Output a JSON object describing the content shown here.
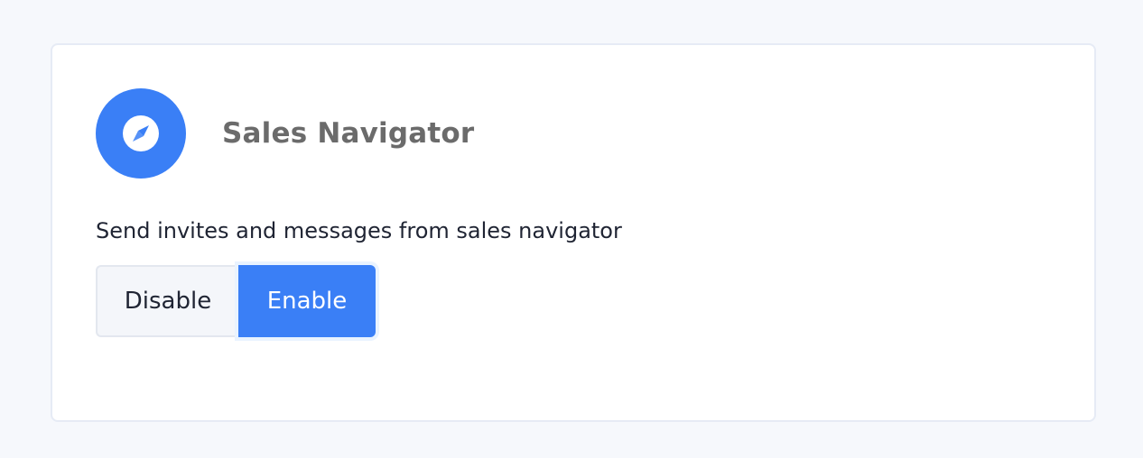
{
  "integration": {
    "title": "Sales Navigator",
    "icon": "compass-icon",
    "description": "Send invites and messages from sales navigator"
  },
  "toggle": {
    "disable_label": "Disable",
    "enable_label": "Enable",
    "selected": "Enable"
  },
  "colors": {
    "accent": "#3a7ff6",
    "page_background": "#f6f8fc",
    "title_text": "#6b6b6b"
  }
}
